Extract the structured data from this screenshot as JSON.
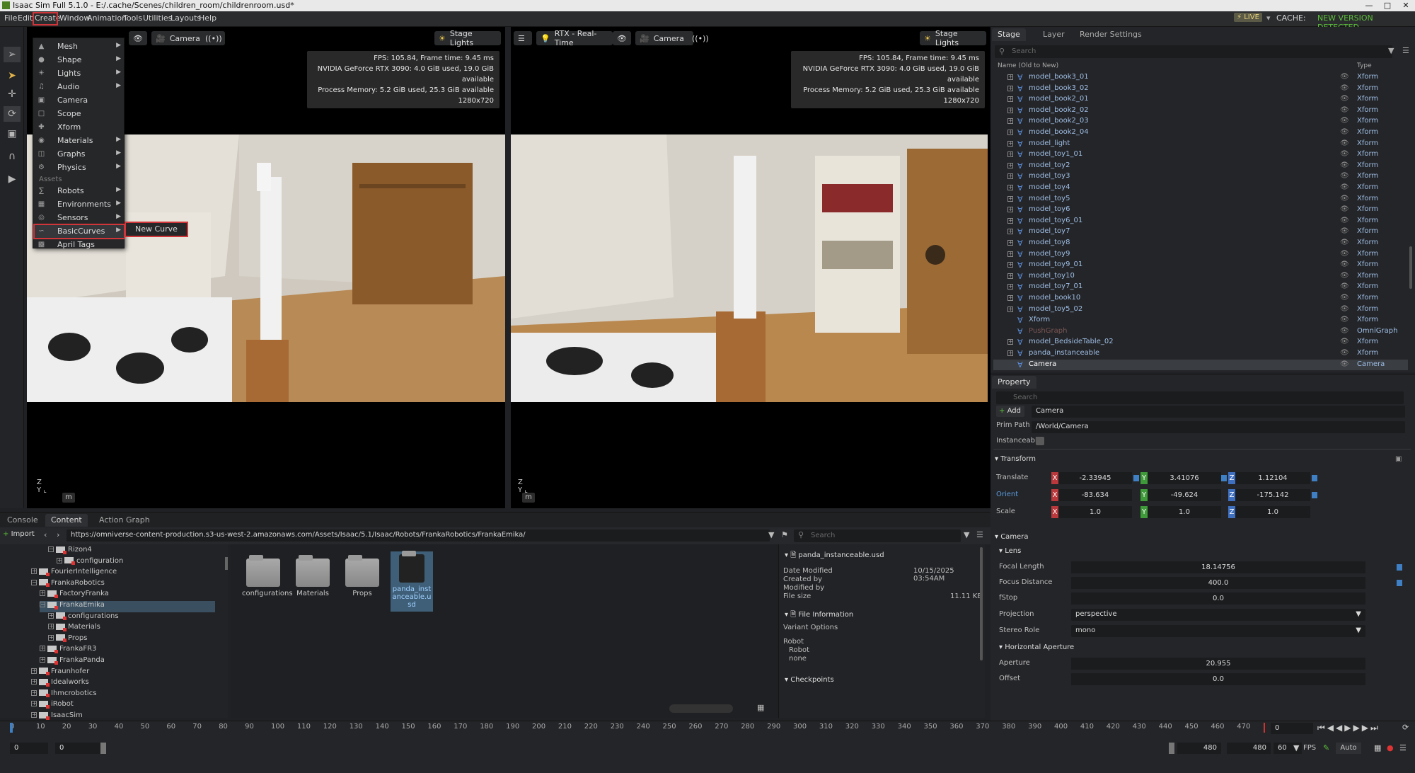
{
  "window": {
    "title": "Isaac Sim Full 5.1.0 - E:/.cache/Scenes/children_room/childrenroom.usd*"
  },
  "menubar": {
    "items": [
      "File",
      "Edit",
      "Create",
      "Window",
      "Animation",
      "Tools",
      "Utilities",
      "Layouts",
      "Help"
    ],
    "live_label": "LIVE",
    "cache_label": "CACHE:",
    "new_version": "NEW VERSION DETECTED"
  },
  "create_menu": {
    "items": [
      {
        "label": "Mesh",
        "sub": true
      },
      {
        "label": "Shape",
        "sub": true
      },
      {
        "label": "Lights",
        "sub": true
      },
      {
        "label": "Audio",
        "sub": true
      },
      {
        "label": "Camera",
        "sub": false
      },
      {
        "label": "Scope",
        "sub": false
      },
      {
        "label": "Xform",
        "sub": false
      },
      {
        "label": "Materials",
        "sub": true
      },
      {
        "label": "Graphs",
        "sub": true
      },
      {
        "label": "Physics",
        "sub": true
      }
    ],
    "assets_header": "Assets",
    "asset_items": [
      {
        "label": "Robots",
        "sub": true
      },
      {
        "label": "Environments",
        "sub": true
      },
      {
        "label": "Sensors",
        "sub": true
      },
      {
        "label": "BasicCurves",
        "sub": true
      },
      {
        "label": "April Tags",
        "sub": false
      }
    ],
    "submenu_item": "New Curve"
  },
  "viewport_left": {
    "camera": "Camera",
    "stage_lights": "Stage Lights",
    "info": [
      "FPS: 105.84, Frame time: 9.45 ms",
      "NVIDIA GeForce RTX 3090: 4.0 GiB used, 19.0 GiB available",
      "Process Memory: 5.2 GiB used, 25.3 GiB available",
      "1280x720"
    ],
    "units": "m"
  },
  "viewport_right": {
    "render_mode": "RTX - Real-Time",
    "camera": "Camera",
    "stage_lights": "Stage Lights",
    "info": [
      "FPS: 105.84, Frame time: 9.45 ms",
      "NVIDIA GeForce RTX 3090: 4.0 GiB used, 19.0 GiB available",
      "Process Memory: 5.2 GiB used, 25.3 GiB available",
      "1280x720"
    ],
    "units": "m"
  },
  "stage": {
    "tabs": [
      "Stage",
      "Layer",
      "Render Settings"
    ],
    "search_placeholder": "Search",
    "col_name": "Name (Old to New)",
    "col_type": "Type",
    "rows": [
      {
        "name": "model_book3_01",
        "type": "Xform",
        "exp": true
      },
      {
        "name": "model_book3_02",
        "type": "Xform",
        "exp": true
      },
      {
        "name": "model_book2_01",
        "type": "Xform",
        "exp": true
      },
      {
        "name": "model_book2_02",
        "type": "Xform",
        "exp": true
      },
      {
        "name": "model_book2_03",
        "type": "Xform",
        "exp": true
      },
      {
        "name": "model_book2_04",
        "type": "Xform",
        "exp": true
      },
      {
        "name": "model_light",
        "type": "Xform",
        "exp": true
      },
      {
        "name": "model_toy1_01",
        "type": "Xform",
        "exp": true
      },
      {
        "name": "model_toy2",
        "type": "Xform",
        "exp": true
      },
      {
        "name": "model_toy3",
        "type": "Xform",
        "exp": true
      },
      {
        "name": "model_toy4",
        "type": "Xform",
        "exp": true
      },
      {
        "name": "model_toy5",
        "type": "Xform",
        "exp": true
      },
      {
        "name": "model_toy6",
        "type": "Xform",
        "exp": true
      },
      {
        "name": "model_toy6_01",
        "type": "Xform",
        "exp": true
      },
      {
        "name": "model_toy7",
        "type": "Xform",
        "exp": true
      },
      {
        "name": "model_toy8",
        "type": "Xform",
        "exp": true
      },
      {
        "name": "model_toy9",
        "type": "Xform",
        "exp": true
      },
      {
        "name": "model_toy9_01",
        "type": "Xform",
        "exp": true
      },
      {
        "name": "model_toy10",
        "type": "Xform",
        "exp": true
      },
      {
        "name": "model_toy7_01",
        "type": "Xform",
        "exp": true
      },
      {
        "name": "model_book10",
        "type": "Xform",
        "exp": true
      },
      {
        "name": "model_toy5_02",
        "type": "Xform",
        "exp": true
      },
      {
        "name": "Xform",
        "type": "Xform",
        "exp": false
      },
      {
        "name": "PushGraph",
        "type": "OmniGraph",
        "exp": false,
        "dim": true
      },
      {
        "name": "model_BedsideTable_02",
        "type": "Xform",
        "exp": true
      },
      {
        "name": "panda_instanceable",
        "type": "Xform",
        "exp": true
      },
      {
        "name": "Camera",
        "type": "Camera",
        "exp": false,
        "selected": true
      }
    ]
  },
  "property": {
    "tab": "Property",
    "search_placeholder": "Search",
    "add_label": "Add",
    "prim_name": "Camera",
    "prim_path_label": "Prim Path",
    "prim_path": "/World/Camera",
    "instanceable_label": "Instanceable",
    "transform_header": "Transform",
    "translate_label": "Translate",
    "translate": [
      "-2.33945",
      "3.41076",
      "1.12104"
    ],
    "orient_label": "Orient",
    "orient": [
      "-83.634",
      "-49.624",
      "-175.142"
    ],
    "scale_label": "Scale",
    "scale": [
      "1.0",
      "1.0",
      "1.0"
    ],
    "camera_header": "Camera",
    "lens_header": "Lens",
    "focal_length_label": "Focal Length",
    "focal_length": "18.14756",
    "focus_distance_label": "Focus Distance",
    "focus_distance": "400.0",
    "fstop_label": "fStop",
    "fstop": "0.0",
    "projection_label": "Projection",
    "projection": "perspective",
    "stereo_label": "Stereo Role",
    "stereo": "mono",
    "haperture_header": "Horizontal Aperture",
    "aperture_label": "Aperture",
    "aperture": "20.955",
    "offset_label": "Offset",
    "offset": "0.0"
  },
  "bottom": {
    "tabs": [
      "Console",
      "Content",
      "Action Graph"
    ],
    "import_label": "Import",
    "path": "https://omniverse-content-production.s3-us-west-2.amazonaws.com/Assets/Isaac/5.1/Isaac/Robots/FrankaRobotics/FrankaEmika/",
    "search_placeholder": "Search",
    "tree": [
      {
        "label": "Rizon4",
        "indent": 3,
        "exp": "-"
      },
      {
        "label": "configuration",
        "indent": 4,
        "exp": "+"
      },
      {
        "label": "FourierIntelligence",
        "indent": 1,
        "exp": "+"
      },
      {
        "label": "FrankaRobotics",
        "indent": 1,
        "exp": "-"
      },
      {
        "label": "FactoryFranka",
        "indent": 2,
        "exp": "+"
      },
      {
        "label": "FrankaEmika",
        "indent": 2,
        "exp": "-",
        "selected": true
      },
      {
        "label": "configurations",
        "indent": 3,
        "exp": "+"
      },
      {
        "label": "Materials",
        "indent": 3,
        "exp": "+"
      },
      {
        "label": "Props",
        "indent": 3,
        "exp": "+"
      },
      {
        "label": "FrankaFR3",
        "indent": 2,
        "exp": "+"
      },
      {
        "label": "FrankaPanda",
        "indent": 2,
        "exp": "+"
      },
      {
        "label": "Fraunhofer",
        "indent": 1,
        "exp": "+"
      },
      {
        "label": "Idealworks",
        "indent": 1,
        "exp": "+"
      },
      {
        "label": "Ihmcrobotics",
        "indent": 1,
        "exp": "+"
      },
      {
        "label": "iRobot",
        "indent": 1,
        "exp": "+"
      },
      {
        "label": "IsaacSim",
        "indent": 1,
        "exp": "+"
      }
    ],
    "files": [
      "configurations",
      "Materials",
      "Props",
      "panda_instanceable.usd"
    ],
    "details": {
      "filename": "panda_instanceable.usd",
      "date_modified_label": "Date Modified",
      "date_modified": "10/15/2025 03:54AM",
      "created_by_label": "Created by",
      "modified_by_label": "Modified by",
      "file_size_label": "File size",
      "file_size": "11.11 KB",
      "file_info_label": "File Information",
      "variant_label": "Variant Options",
      "robot_label": "Robot",
      "robot_options": [
        "Robot",
        "none"
      ],
      "checkpoints_label": "Checkpoints"
    }
  },
  "timeline": {
    "ticks": [
      "0",
      "10",
      "20",
      "30",
      "40",
      "50",
      "60",
      "70",
      "80",
      "90",
      "100",
      "110",
      "120",
      "130",
      "140",
      "150",
      "160",
      "170",
      "180",
      "190",
      "200",
      "210",
      "220",
      "230",
      "240",
      "250",
      "260",
      "270",
      "280",
      "290",
      "300",
      "310",
      "320",
      "330",
      "340",
      "350",
      "360",
      "370",
      "380",
      "390",
      "400",
      "410",
      "420",
      "430",
      "440",
      "450",
      "460",
      "470"
    ],
    "current_frame": "0",
    "start": "0",
    "start2": "0",
    "end": "480",
    "end2": "480",
    "fps": "60",
    "fps_label": "FPS",
    "auto_label": "Auto"
  }
}
